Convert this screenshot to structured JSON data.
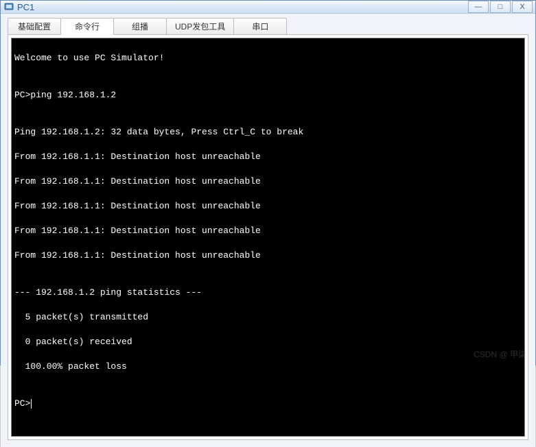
{
  "window": {
    "title": "PC1"
  },
  "tabs": {
    "t0": "基础配置",
    "t1": "命令行",
    "t2": "组播",
    "t3": "UDP发包工具",
    "t4": "串口"
  },
  "terminal": {
    "welcome": "Welcome to use PC Simulator!",
    "blank": "",
    "prompt_cmd": "PC>ping 192.168.1.2",
    "ping_header": "Ping 192.168.1.2: 32 data bytes, Press Ctrl_C to break",
    "reply1": "From 192.168.1.1: Destination host unreachable",
    "reply2": "From 192.168.1.1: Destination host unreachable",
    "reply3": "From 192.168.1.1: Destination host unreachable",
    "reply4": "From 192.168.1.1: Destination host unreachable",
    "reply5": "From 192.168.1.1: Destination host unreachable",
    "stats_hdr": "--- 192.168.1.2 ping statistics ---",
    "stats_tx": "  5 packet(s) transmitted",
    "stats_rx": "  0 packet(s) received",
    "stats_loss": "  100.00% packet loss",
    "prompt_empty": "PC>"
  },
  "watermark": "CSDN @ 甲柒"
}
